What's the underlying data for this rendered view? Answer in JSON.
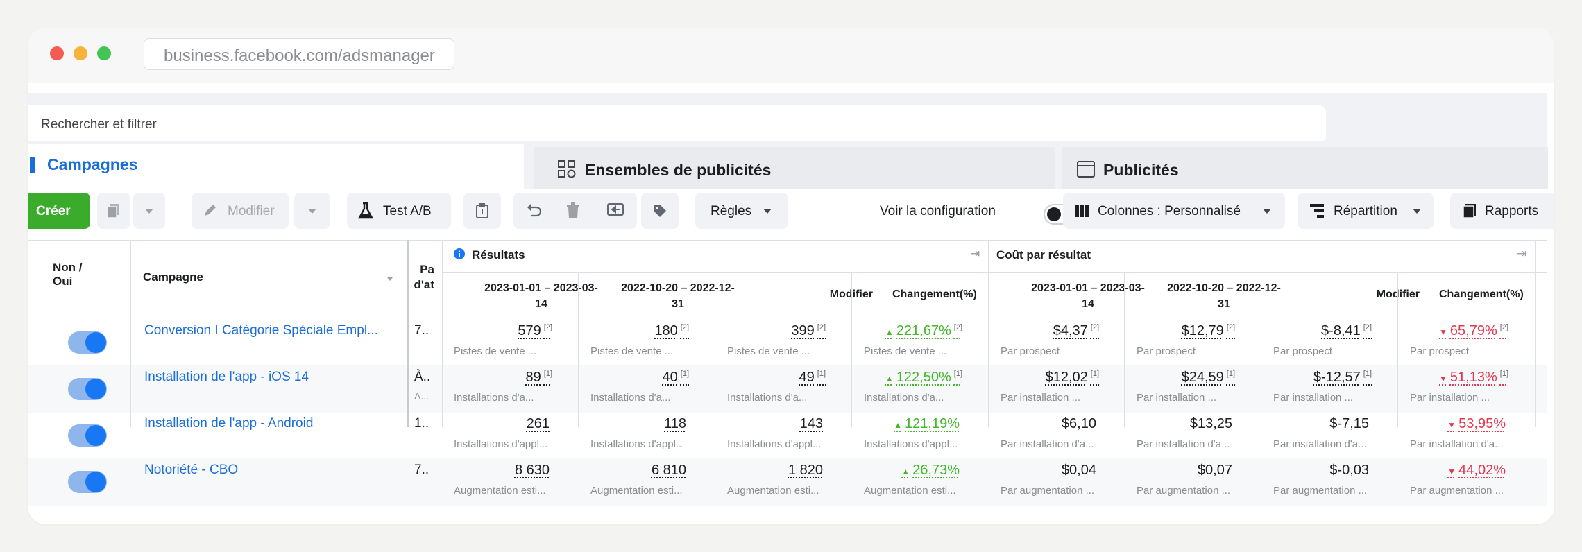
{
  "browser": {
    "url": "business.facebook.com/adsmanager"
  },
  "search": {
    "placeholder": "Rechercher et filtrer"
  },
  "tabs": {
    "campaigns": "Campagnes",
    "adsets": "Ensembles de publicités",
    "ads": "Publicités"
  },
  "toolbar": {
    "create": "Créer",
    "edit": "Modifier",
    "ab_test": "Test A/B",
    "rules": "Règles",
    "view_config": "Voir la configuration",
    "columns": "Colonnes : Personnalisé",
    "breakdown": "Répartition",
    "reports": "Rapports"
  },
  "table": {
    "headers": {
      "on_off": "Non / Oui",
      "campaign": "Campagne",
      "pa": "Pa d'at",
      "results_group": "Résultats",
      "cost_group": "Coût par résultat",
      "period1": "2023-01-01 – 2023-03-14",
      "period2": "2022-10-20 – 2022-12-31",
      "modify": "Modifier",
      "change": "Changement(%)"
    },
    "rows": [
      {
        "campaign": "Conversion I Catégorie Spéciale Empl...",
        "pa": "7..",
        "pa_sub": "",
        "enabled": true,
        "results": [
          "579",
          "180",
          "399",
          "221,67%"
        ],
        "results_notes": [
          "[2]",
          "[2]",
          "[2]",
          "[2]"
        ],
        "results_sub": "Pistes de vente ...",
        "costs": [
          "$4,37",
          "$12,79",
          "$-8,41",
          "65,79%"
        ],
        "costs_notes": [
          "[2]",
          "[2]",
          "[2]",
          "[2]"
        ],
        "costs_sub": "Par prospect"
      },
      {
        "campaign": "Installation de l'app - iOS 14",
        "pa": "À..",
        "pa_sub": "A...",
        "enabled": true,
        "results": [
          "89",
          "40",
          "49",
          "122,50%"
        ],
        "results_notes": [
          "[1]",
          "[1]",
          "[1]",
          "[1]"
        ],
        "results_sub": "Installations d'a...",
        "costs": [
          "$12,02",
          "$24,59",
          "$-12,57",
          "51,13%"
        ],
        "costs_notes": [
          "[1]",
          "[1]",
          "[1]",
          "[1]"
        ],
        "costs_sub": "Par installation ..."
      },
      {
        "campaign": "Installation de l'app - Android",
        "pa": "1..",
        "pa_sub": "",
        "enabled": true,
        "results": [
          "261",
          "118",
          "143",
          "121,19%"
        ],
        "results_notes": [
          "",
          "",
          "",
          ""
        ],
        "results_sub": "Installations d'appl...",
        "costs": [
          "$6,10",
          "$13,25",
          "$-7,15",
          "53,95%"
        ],
        "costs_notes": [
          "",
          "",
          "",
          ""
        ],
        "costs_sub": "Par installation d'a..."
      },
      {
        "campaign": "Notoriété - CBO",
        "pa": "7..",
        "pa_sub": "",
        "enabled": true,
        "results": [
          "8 630",
          "6 810",
          "1 820",
          "26,73%"
        ],
        "results_notes": [
          "",
          "",
          "",
          ""
        ],
        "results_sub": "Augmentation esti...",
        "costs": [
          "$0,04",
          "$0,07",
          "$-0,03",
          "44,02%"
        ],
        "costs_notes": [
          "",
          "",
          "",
          ""
        ],
        "costs_sub": "Par augmentation ..."
      }
    ]
  },
  "colors": {
    "accent": "#1a6ed8",
    "create": "#3bab2c",
    "up": "#42b72a",
    "down": "#e0384f"
  }
}
